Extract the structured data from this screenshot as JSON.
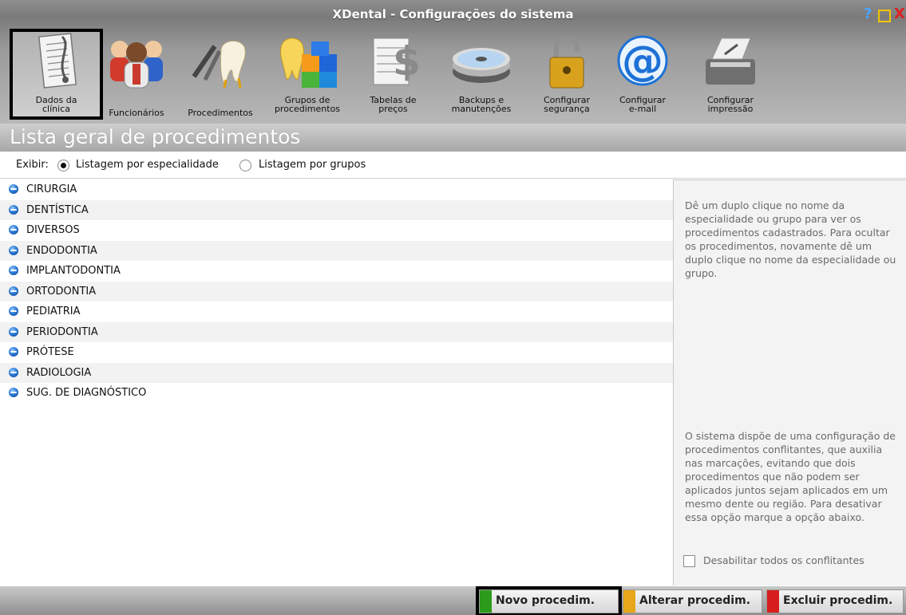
{
  "window": {
    "title": "XDental - Configurações do sistema",
    "help": "?",
    "close": "X"
  },
  "toolbar": [
    {
      "id": "dados",
      "label": "Dados da clínica",
      "icon": "document-stethoscope-icon",
      "selected": true
    },
    {
      "id": "func",
      "label": "Funcionários",
      "icon": "staff-people-icon"
    },
    {
      "id": "proc",
      "label": "Procedimentos",
      "icon": "tooth-extraction-icon"
    },
    {
      "id": "grupos",
      "label": "Grupos de procedimentos",
      "icon": "tooth-blocks-icon"
    },
    {
      "id": "tabelas",
      "label": "Tabelas de preços",
      "icon": "price-table-dollar-icon"
    },
    {
      "id": "backups",
      "label": "Backups e manutenções",
      "icon": "discs-icon"
    },
    {
      "id": "seg",
      "label": "Configurar segurança",
      "icon": "padlock-icon"
    },
    {
      "id": "email",
      "label": "Configurar e-mail",
      "icon": "at-sign-icon"
    },
    {
      "id": "imp",
      "label": "Configurar impressão",
      "icon": "printer-icon"
    }
  ],
  "section_title": "Lista geral de procedimentos",
  "filter": {
    "label": "Exibir:",
    "option1": "Listagem por especialidade",
    "option2": "Listagem por grupos",
    "selected": "option1"
  },
  "specialties": [
    "CIRURGIA",
    "DENTÍSTICA",
    "DIVERSOS",
    "ENDODONTIA",
    "IMPLANTODONTIA",
    "ORTODONTIA",
    "PEDIATRIA",
    "PERIODONTIA",
    "PRÓTESE",
    "RADIOLOGIA",
    "SUG. DE DIAGNÓSTICO"
  ],
  "side_panel": {
    "help_text": "Dê um duplo clique no nome da especialidade ou grupo para ver os procedimentos cadastrados. Para ocultar os procedimentos, novamente dê um duplo clique no nome da especialidade ou grupo.",
    "conflict_text": "O sistema dispõe de uma configuração de procedimentos conflitantes, que auxilia nas marcações, evitando que dois procedimentos que não podem ser aplicados juntos sejam aplicados em um mesmo dente ou região. Para desativar essa opção marque a opção abaixo.",
    "checkbox_label": "Desabilitar todos os conflitantes",
    "checkbox_checked": false
  },
  "buttons": {
    "novo": {
      "label": "Novo procedim.",
      "color": "#2c9a1a"
    },
    "alterar": {
      "label": "Alterar procedim.",
      "color": "#e7a71a"
    },
    "excluir": {
      "label": "Excluir procedim.",
      "color": "#d81d1d"
    }
  }
}
